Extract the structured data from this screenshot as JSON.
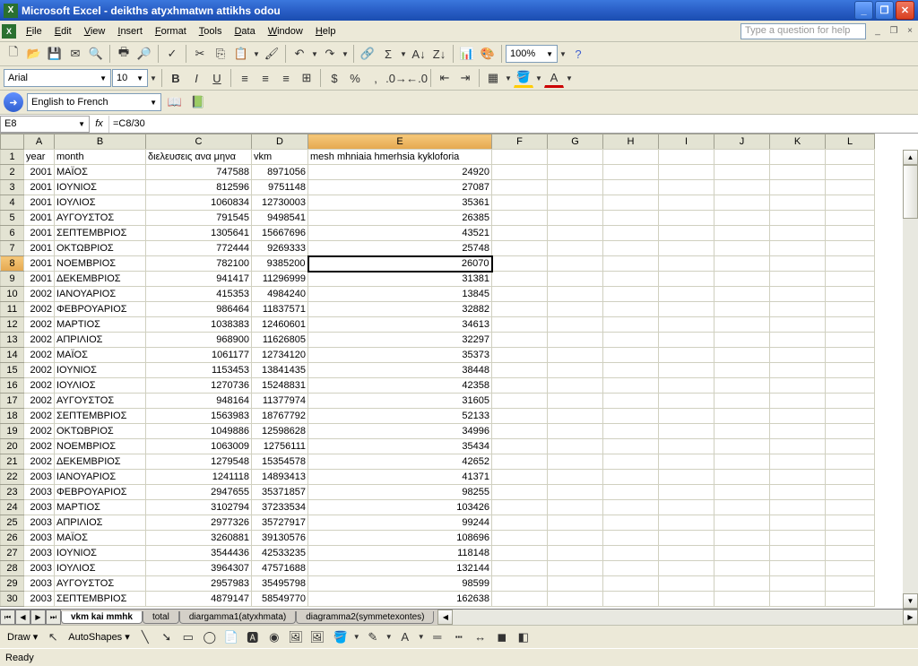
{
  "titlebar": {
    "app": "Microsoft Excel",
    "doc": "deikths atyxhmatwn attikhs odou"
  },
  "menus": [
    "File",
    "Edit",
    "View",
    "Insert",
    "Format",
    "Tools",
    "Data",
    "Window",
    "Help"
  ],
  "help_placeholder": "Type a question for help",
  "font": {
    "name": "Arial",
    "size": "10"
  },
  "zoom": "100%",
  "translate": "English to French",
  "name_box": "E8",
  "formula": "=C8/30",
  "columns": [
    "A",
    "B",
    "C",
    "D",
    "E",
    "F",
    "G",
    "H",
    "I",
    "J",
    "K",
    "L"
  ],
  "selected_col": "E",
  "selected_row": 8,
  "headers": {
    "A": "year",
    "B": "month",
    "C": "διελευσεις ανα μηνα",
    "D": "vkm",
    "E": "mesh mhniaia hmerhsia kykloforia"
  },
  "rows": [
    {
      "r": 2,
      "A": "2001",
      "B": "ΜΑΪΟΣ",
      "C": "747588",
      "D": "8971056",
      "E": "24920"
    },
    {
      "r": 3,
      "A": "2001",
      "B": "ΙΟΥΝΙΟΣ",
      "C": "812596",
      "D": "9751148",
      "E": "27087"
    },
    {
      "r": 4,
      "A": "2001",
      "B": "ΙΟΥΛΙΟΣ",
      "C": "1060834",
      "D": "12730003",
      "E": "35361"
    },
    {
      "r": 5,
      "A": "2001",
      "B": "ΑΥΓΟΥΣΤΟΣ",
      "C": "791545",
      "D": "9498541",
      "E": "26385"
    },
    {
      "r": 6,
      "A": "2001",
      "B": "ΣΕΠΤΕΜΒΡΙΟΣ",
      "C": "1305641",
      "D": "15667696",
      "E": "43521"
    },
    {
      "r": 7,
      "A": "2001",
      "B": "ΟΚΤΩΒΡΙΟΣ",
      "C": "772444",
      "D": "9269333",
      "E": "25748"
    },
    {
      "r": 8,
      "A": "2001",
      "B": "ΝΟΕΜΒΡΙΟΣ",
      "C": "782100",
      "D": "9385200",
      "E": "26070"
    },
    {
      "r": 9,
      "A": "2001",
      "B": "ΔΕΚΕΜΒΡΙΟΣ",
      "C": "941417",
      "D": "11296999",
      "E": "31381"
    },
    {
      "r": 10,
      "A": "2002",
      "B": "ΙΑΝΟΥΑΡΙΟΣ",
      "C": "415353",
      "D": "4984240",
      "E": "13845"
    },
    {
      "r": 11,
      "A": "2002",
      "B": "ΦΕΒΡΟΥΑΡΙΟΣ",
      "C": "986464",
      "D": "11837571",
      "E": "32882"
    },
    {
      "r": 12,
      "A": "2002",
      "B": "ΜΑΡΤΙΟΣ",
      "C": "1038383",
      "D": "12460601",
      "E": "34613"
    },
    {
      "r": 13,
      "A": "2002",
      "B": "ΑΠΡΙΛΙΟΣ",
      "C": "968900",
      "D": "11626805",
      "E": "32297"
    },
    {
      "r": 14,
      "A": "2002",
      "B": "ΜΑΪΟΣ",
      "C": "1061177",
      "D": "12734120",
      "E": "35373"
    },
    {
      "r": 15,
      "A": "2002",
      "B": "ΙΟΥΝΙΟΣ",
      "C": "1153453",
      "D": "13841435",
      "E": "38448"
    },
    {
      "r": 16,
      "A": "2002",
      "B": "ΙΟΥΛΙΟΣ",
      "C": "1270736",
      "D": "15248831",
      "E": "42358"
    },
    {
      "r": 17,
      "A": "2002",
      "B": "ΑΥΓΟΥΣΤΟΣ",
      "C": "948164",
      "D": "11377974",
      "E": "31605"
    },
    {
      "r": 18,
      "A": "2002",
      "B": "ΣΕΠΤΕΜΒΡΙΟΣ",
      "C": "1563983",
      "D": "18767792",
      "E": "52133"
    },
    {
      "r": 19,
      "A": "2002",
      "B": "ΟΚΤΩΒΡΙΟΣ",
      "C": "1049886",
      "D": "12598628",
      "E": "34996"
    },
    {
      "r": 20,
      "A": "2002",
      "B": "ΝΟΕΜΒΡΙΟΣ",
      "C": "1063009",
      "D": "12756111",
      "E": "35434"
    },
    {
      "r": 21,
      "A": "2002",
      "B": "ΔΕΚΕΜΒΡΙΟΣ",
      "C": "1279548",
      "D": "15354578",
      "E": "42652"
    },
    {
      "r": 22,
      "A": "2003",
      "B": "ΙΑΝΟΥΑΡΙΟΣ",
      "C": "1241118",
      "D": "14893413",
      "E": "41371"
    },
    {
      "r": 23,
      "A": "2003",
      "B": "ΦΕΒΡΟΥΑΡΙΟΣ",
      "C": "2947655",
      "D": "35371857",
      "E": "98255"
    },
    {
      "r": 24,
      "A": "2003",
      "B": "ΜΑΡΤΙΟΣ",
      "C": "3102794",
      "D": "37233534",
      "E": "103426"
    },
    {
      "r": 25,
      "A": "2003",
      "B": "ΑΠΡΙΛΙΟΣ",
      "C": "2977326",
      "D": "35727917",
      "E": "99244"
    },
    {
      "r": 26,
      "A": "2003",
      "B": "ΜΑΪΟΣ",
      "C": "3260881",
      "D": "39130576",
      "E": "108696"
    },
    {
      "r": 27,
      "A": "2003",
      "B": "ΙΟΥΝΙΟΣ",
      "C": "3544436",
      "D": "42533235",
      "E": "118148"
    },
    {
      "r": 28,
      "A": "2003",
      "B": "ΙΟΥΛΙΟΣ",
      "C": "3964307",
      "D": "47571688",
      "E": "132144"
    },
    {
      "r": 29,
      "A": "2003",
      "B": "ΑΥΓΟΥΣΤΟΣ",
      "C": "2957983",
      "D": "35495798",
      "E": "98599"
    },
    {
      "r": 30,
      "A": "2003",
      "B": "ΣΕΠΤΕΜΒΡΙΟΣ",
      "C": "4879147",
      "D": "58549770",
      "E": "162638"
    }
  ],
  "sheets": [
    "vkm kai mmhk",
    "total",
    "diargamma1(atyxhmata)",
    "diagramma2(symmetexontes)"
  ],
  "active_sheet": 0,
  "draw": {
    "label": "Draw",
    "autoshapes": "AutoShapes"
  },
  "status": "Ready"
}
